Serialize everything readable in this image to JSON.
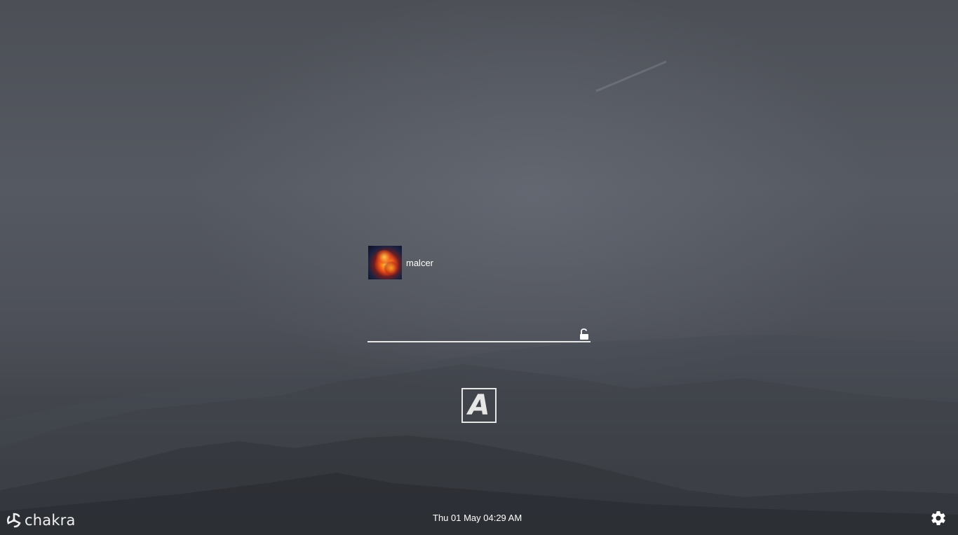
{
  "user": {
    "name": "malcer",
    "avatar_icon": "user-avatar-fire-nebula"
  },
  "login": {
    "password_value": "",
    "password_placeholder": "",
    "submit_icon": "lock-icon"
  },
  "keyboard_layout": {
    "label": "A"
  },
  "branding": {
    "logo_text": "chakra",
    "logo_icon": "chakra-logo-icon"
  },
  "status_bar": {
    "datetime": "Thu 01 May 04:29 AM",
    "settings_icon": "gear-icon"
  },
  "colors": {
    "text": "#ffffff",
    "underline": "#e8e8e8",
    "background_top": "#4c4f56",
    "background_bottom": "#33363b"
  }
}
